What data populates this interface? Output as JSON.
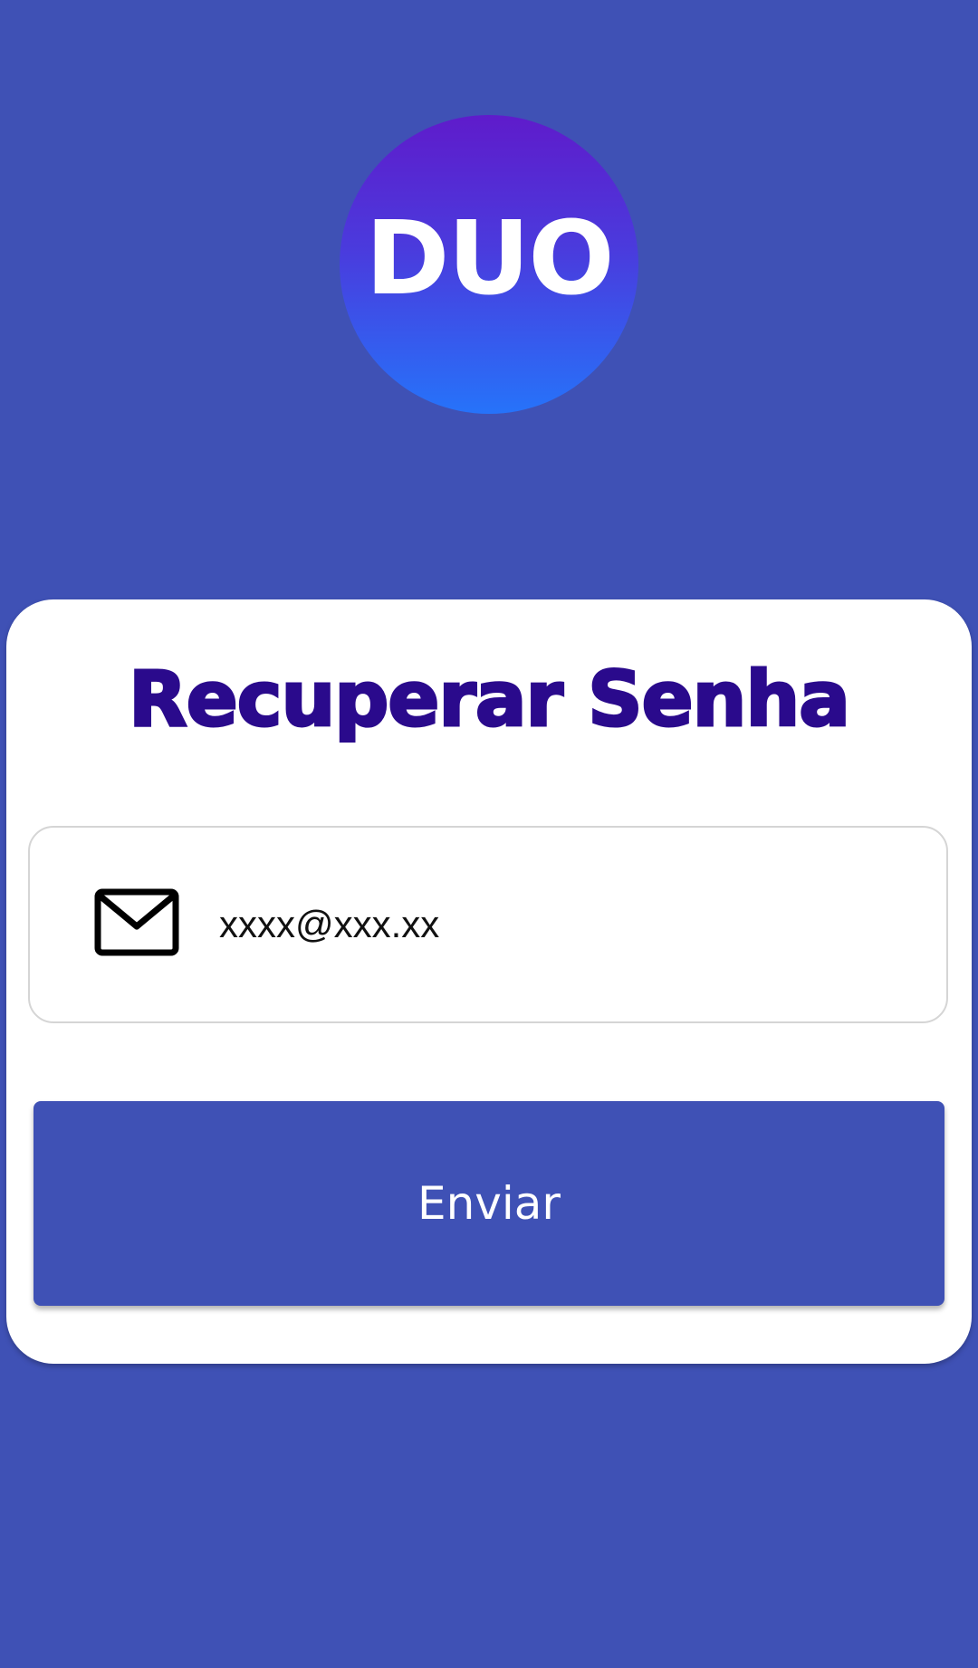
{
  "logo": {
    "text": "DUO",
    "gradient_top": "#5F1BCB",
    "gradient_bottom": "#2673FA"
  },
  "card": {
    "title": "Recuperar Senha",
    "email_field": {
      "icon": "mail-icon",
      "value": "xxxx@xxx.xx"
    },
    "send_button": {
      "label": "Enviar"
    }
  },
  "colors": {
    "background": "#3F51B5",
    "title": "#2A0A8C",
    "button": "#3F51B5"
  }
}
